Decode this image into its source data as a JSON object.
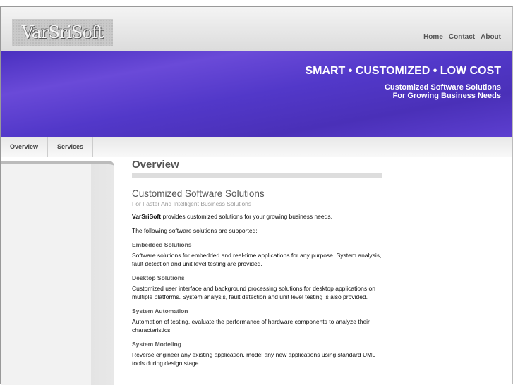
{
  "header": {
    "logo": "VarSriSoft",
    "links": [
      "Home",
      "Contact",
      "About"
    ]
  },
  "banner": {
    "tagline": "SMART • CUSTOMIZED • LOW COST",
    "sub1": "Customized Software Solutions",
    "sub2": "For Growing Business Needs"
  },
  "tabs": [
    "Overview",
    "Services"
  ],
  "content": {
    "title": "Overview",
    "heading": "Customized Software Solutions",
    "subheading": "For Faster And Intelligent Business Solutions",
    "intro_brand": "VarSriSoft",
    "intro_rest": " provides customized solutions for your growing business needs.",
    "supported": "The following software solutions are supported:",
    "sections": [
      {
        "title": "Embedded Solutions",
        "text": "Software solutions for embedded and real-time applications for any purpose. System analysis, fault detection and unit level testing are provided."
      },
      {
        "title": "Desktop Solutions",
        "text": "Customized user interface and background processing solutions for desktop applications on multiple platforms. System analysis, fault detection and unit level testing is also provided."
      },
      {
        "title": "System Automation",
        "text": "Automation of testing, evaluate the performance of hardware components to analyze their characteristics."
      },
      {
        "title": "System Modeling",
        "text": "Reverse engineer any existing application, model any new applications using standard UML tools during design stage."
      }
    ]
  }
}
